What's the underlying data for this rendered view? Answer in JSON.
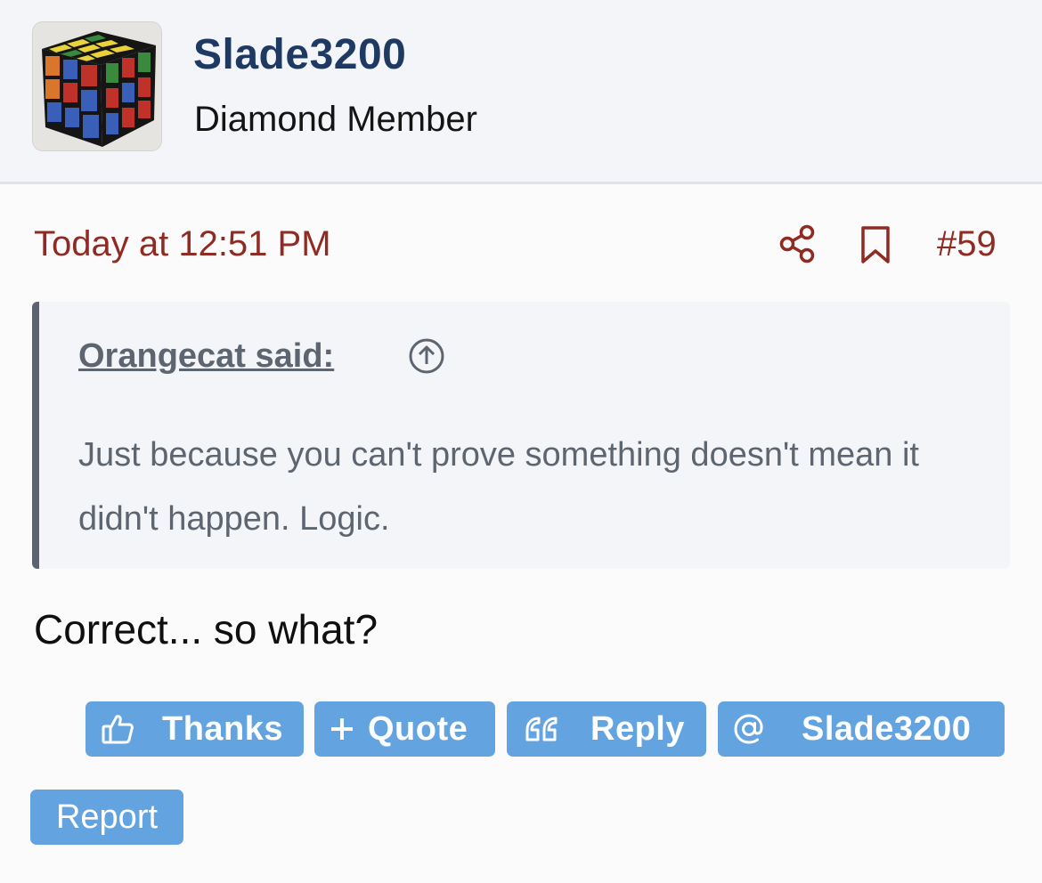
{
  "user": {
    "name": "Slade3200",
    "title": "Diamond Member",
    "avatar": "rubiks-cube-avatar"
  },
  "post": {
    "date": "Today at 12:51 PM",
    "number": "#59",
    "body": "Correct... so what?"
  },
  "quote": {
    "author_label": "Orangecat said:",
    "text": "Just because you can't prove something doesn't mean it didn't happen. Logic."
  },
  "actions": {
    "thanks": "Thanks",
    "quote": "Quote",
    "reply": "Reply",
    "mention": "Slade3200",
    "report": "Report"
  },
  "icons": {
    "share": "share-icon",
    "bookmark": "bookmark-icon",
    "quote_jump": "arrow-up-circle-icon",
    "thanks": "thumbs-up-icon",
    "quote": "plus-icon",
    "reply": "quote-marks-icon",
    "mention": "at-sign-icon"
  },
  "colors": {
    "username": "#1f3a62",
    "date": "#8f2b22",
    "button": "#63a3e0",
    "quote_border": "#5b6370"
  }
}
